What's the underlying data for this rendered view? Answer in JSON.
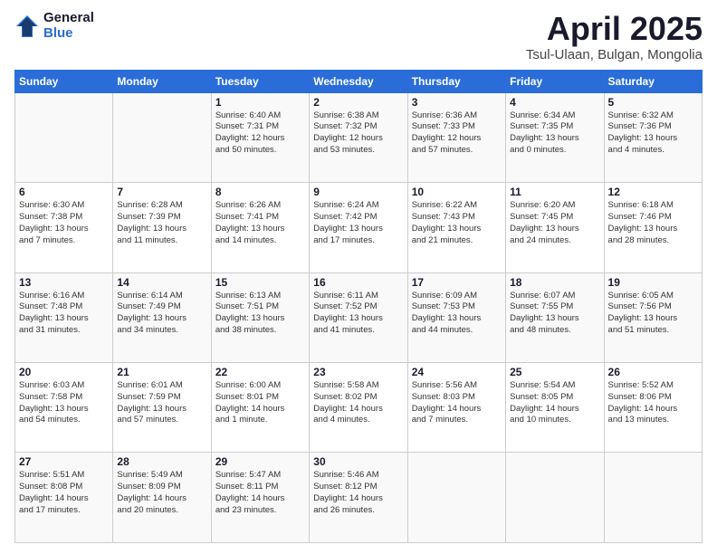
{
  "header": {
    "logo_general": "General",
    "logo_blue": "Blue",
    "month": "April 2025",
    "location": "Tsul-Ulaan, Bulgan, Mongolia"
  },
  "weekdays": [
    "Sunday",
    "Monday",
    "Tuesday",
    "Wednesday",
    "Thursday",
    "Friday",
    "Saturday"
  ],
  "weeks": [
    [
      {
        "day": "",
        "info": ""
      },
      {
        "day": "",
        "info": ""
      },
      {
        "day": "1",
        "info": "Sunrise: 6:40 AM\nSunset: 7:31 PM\nDaylight: 12 hours\nand 50 minutes."
      },
      {
        "day": "2",
        "info": "Sunrise: 6:38 AM\nSunset: 7:32 PM\nDaylight: 12 hours\nand 53 minutes."
      },
      {
        "day": "3",
        "info": "Sunrise: 6:36 AM\nSunset: 7:33 PM\nDaylight: 12 hours\nand 57 minutes."
      },
      {
        "day": "4",
        "info": "Sunrise: 6:34 AM\nSunset: 7:35 PM\nDaylight: 13 hours\nand 0 minutes."
      },
      {
        "day": "5",
        "info": "Sunrise: 6:32 AM\nSunset: 7:36 PM\nDaylight: 13 hours\nand 4 minutes."
      }
    ],
    [
      {
        "day": "6",
        "info": "Sunrise: 6:30 AM\nSunset: 7:38 PM\nDaylight: 13 hours\nand 7 minutes."
      },
      {
        "day": "7",
        "info": "Sunrise: 6:28 AM\nSunset: 7:39 PM\nDaylight: 13 hours\nand 11 minutes."
      },
      {
        "day": "8",
        "info": "Sunrise: 6:26 AM\nSunset: 7:41 PM\nDaylight: 13 hours\nand 14 minutes."
      },
      {
        "day": "9",
        "info": "Sunrise: 6:24 AM\nSunset: 7:42 PM\nDaylight: 13 hours\nand 17 minutes."
      },
      {
        "day": "10",
        "info": "Sunrise: 6:22 AM\nSunset: 7:43 PM\nDaylight: 13 hours\nand 21 minutes."
      },
      {
        "day": "11",
        "info": "Sunrise: 6:20 AM\nSunset: 7:45 PM\nDaylight: 13 hours\nand 24 minutes."
      },
      {
        "day": "12",
        "info": "Sunrise: 6:18 AM\nSunset: 7:46 PM\nDaylight: 13 hours\nand 28 minutes."
      }
    ],
    [
      {
        "day": "13",
        "info": "Sunrise: 6:16 AM\nSunset: 7:48 PM\nDaylight: 13 hours\nand 31 minutes."
      },
      {
        "day": "14",
        "info": "Sunrise: 6:14 AM\nSunset: 7:49 PM\nDaylight: 13 hours\nand 34 minutes."
      },
      {
        "day": "15",
        "info": "Sunrise: 6:13 AM\nSunset: 7:51 PM\nDaylight: 13 hours\nand 38 minutes."
      },
      {
        "day": "16",
        "info": "Sunrise: 6:11 AM\nSunset: 7:52 PM\nDaylight: 13 hours\nand 41 minutes."
      },
      {
        "day": "17",
        "info": "Sunrise: 6:09 AM\nSunset: 7:53 PM\nDaylight: 13 hours\nand 44 minutes."
      },
      {
        "day": "18",
        "info": "Sunrise: 6:07 AM\nSunset: 7:55 PM\nDaylight: 13 hours\nand 48 minutes."
      },
      {
        "day": "19",
        "info": "Sunrise: 6:05 AM\nSunset: 7:56 PM\nDaylight: 13 hours\nand 51 minutes."
      }
    ],
    [
      {
        "day": "20",
        "info": "Sunrise: 6:03 AM\nSunset: 7:58 PM\nDaylight: 13 hours\nand 54 minutes."
      },
      {
        "day": "21",
        "info": "Sunrise: 6:01 AM\nSunset: 7:59 PM\nDaylight: 13 hours\nand 57 minutes."
      },
      {
        "day": "22",
        "info": "Sunrise: 6:00 AM\nSunset: 8:01 PM\nDaylight: 14 hours\nand 1 minute."
      },
      {
        "day": "23",
        "info": "Sunrise: 5:58 AM\nSunset: 8:02 PM\nDaylight: 14 hours\nand 4 minutes."
      },
      {
        "day": "24",
        "info": "Sunrise: 5:56 AM\nSunset: 8:03 PM\nDaylight: 14 hours\nand 7 minutes."
      },
      {
        "day": "25",
        "info": "Sunrise: 5:54 AM\nSunset: 8:05 PM\nDaylight: 14 hours\nand 10 minutes."
      },
      {
        "day": "26",
        "info": "Sunrise: 5:52 AM\nSunset: 8:06 PM\nDaylight: 14 hours\nand 13 minutes."
      }
    ],
    [
      {
        "day": "27",
        "info": "Sunrise: 5:51 AM\nSunset: 8:08 PM\nDaylight: 14 hours\nand 17 minutes."
      },
      {
        "day": "28",
        "info": "Sunrise: 5:49 AM\nSunset: 8:09 PM\nDaylight: 14 hours\nand 20 minutes."
      },
      {
        "day": "29",
        "info": "Sunrise: 5:47 AM\nSunset: 8:11 PM\nDaylight: 14 hours\nand 23 minutes."
      },
      {
        "day": "30",
        "info": "Sunrise: 5:46 AM\nSunset: 8:12 PM\nDaylight: 14 hours\nand 26 minutes."
      },
      {
        "day": "",
        "info": ""
      },
      {
        "day": "",
        "info": ""
      },
      {
        "day": "",
        "info": ""
      }
    ]
  ]
}
